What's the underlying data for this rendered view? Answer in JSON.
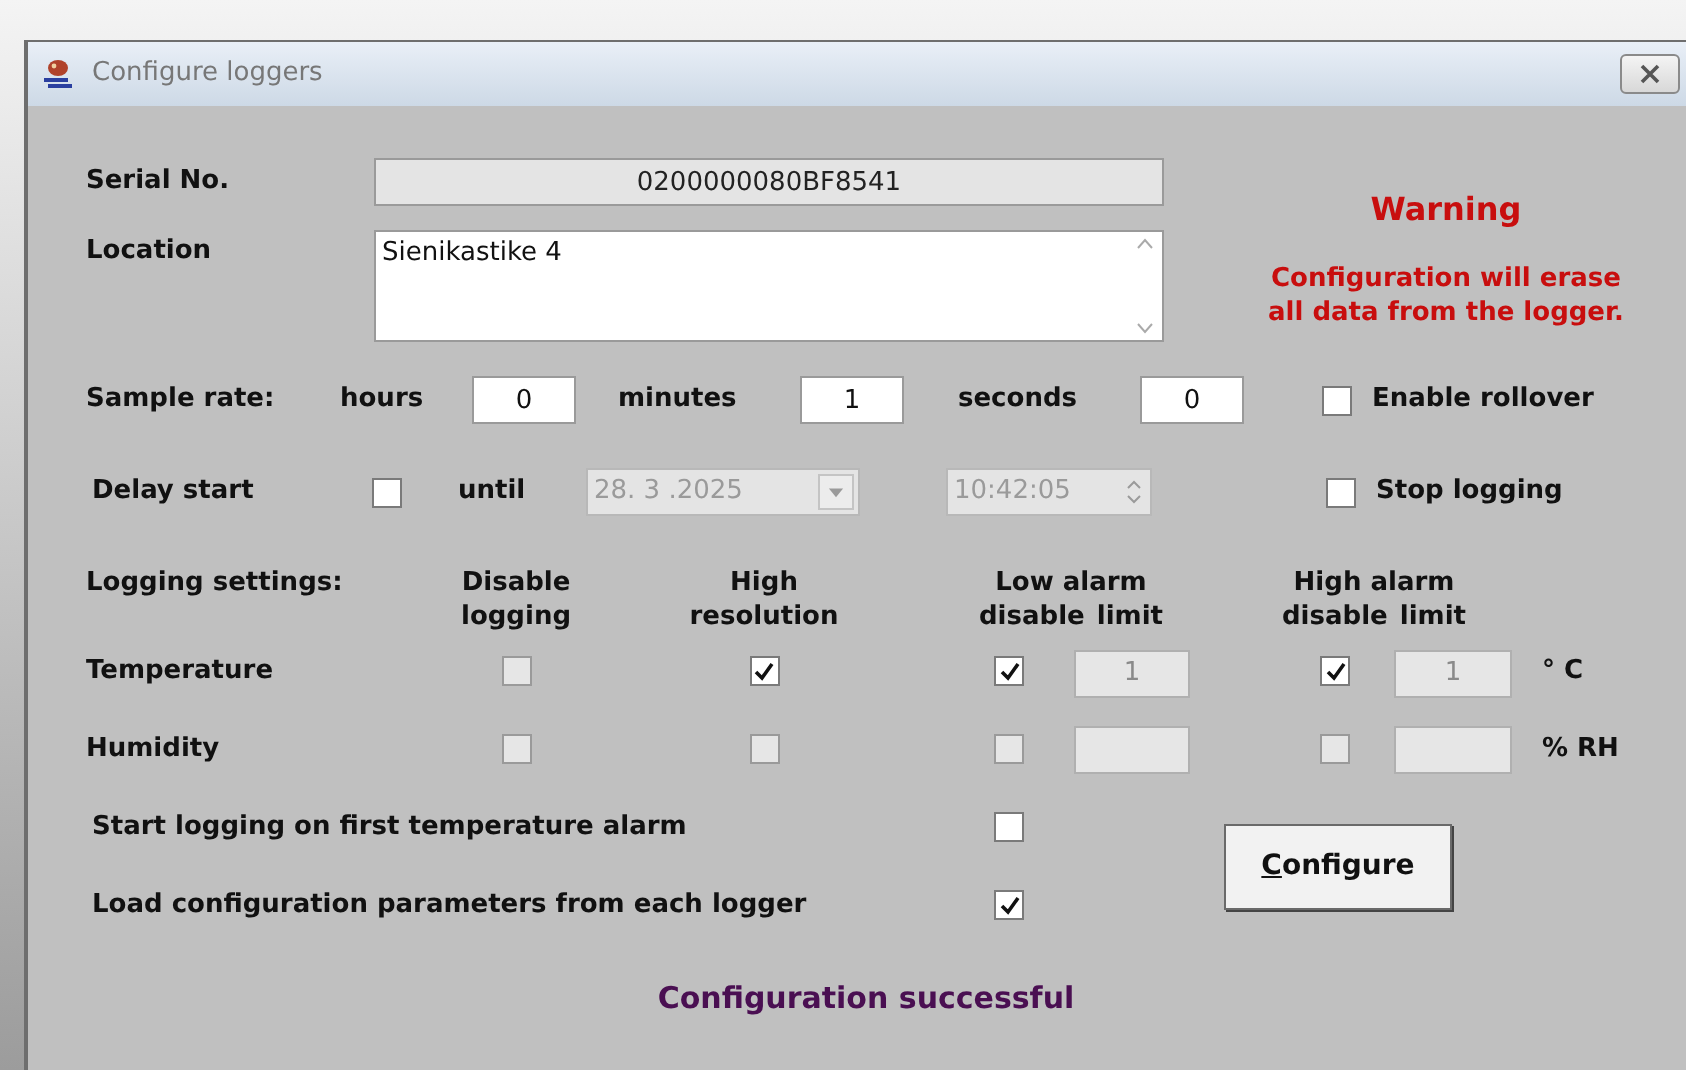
{
  "window": {
    "title": "Configure loggers"
  },
  "serial": {
    "label": "Serial No.",
    "value": "0200000080BF8541"
  },
  "location": {
    "label": "Location",
    "value": "Sienikastike 4"
  },
  "warning": {
    "title": "Warning",
    "message": "Configuration will erase all data from the logger."
  },
  "sample_rate": {
    "label": "Sample rate:",
    "fields": [
      {
        "label": "hours",
        "value": "0"
      },
      {
        "label": "minutes",
        "value": "1"
      },
      {
        "label": "seconds",
        "value": "0"
      }
    ]
  },
  "enable_rollover": {
    "label": "Enable rollover",
    "checked": false
  },
  "delay_start": {
    "label": "Delay start",
    "checked": false,
    "until_label": "until",
    "date": "28. 3 .2025",
    "time": "10:42:05",
    "disabled": true
  },
  "stop_logging": {
    "label": "Stop logging",
    "checked": false
  },
  "logging_settings": {
    "label": "Logging settings:",
    "disable_header": "Disable logging",
    "resolution_header": "High resolution",
    "low_alarm_header": {
      "title": "Low alarm",
      "subtitles": [
        "disable",
        "limit"
      ]
    },
    "high_alarm_header": {
      "title": "High alarm",
      "subtitles": [
        "disable",
        "limit"
      ]
    }
  },
  "rows": [
    {
      "name": "Temperature",
      "unit": "° C",
      "disable_logging": {
        "checked": false,
        "disabled": true
      },
      "high_resolution": {
        "checked": true,
        "disabled": false
      },
      "low_alarm": {
        "disable": {
          "checked": true,
          "disabled": false
        },
        "limit": {
          "value": "1",
          "disabled": true
        }
      },
      "high_alarm": {
        "disable": {
          "checked": true,
          "disabled": false
        },
        "limit": {
          "value": "1",
          "disabled": true
        }
      }
    },
    {
      "name": "Humidity",
      "unit": "% RH",
      "disable_logging": {
        "checked": false,
        "disabled": true
      },
      "high_resolution": {
        "checked": false,
        "disabled": true
      },
      "low_alarm": {
        "disable": {
          "checked": false,
          "disabled": true
        },
        "limit": {
          "disabled": true
        }
      },
      "high_alarm": {
        "disable": {
          "checked": false,
          "disabled": true
        },
        "limit": {
          "disabled": true
        }
      }
    }
  ],
  "options": [
    {
      "label": "Start logging on first temperature alarm",
      "checked": false
    },
    {
      "label": "Load configuration parameters from each logger",
      "checked": true
    }
  ],
  "configure_button": {
    "label": "Configure"
  },
  "status": "Configuration successful"
}
